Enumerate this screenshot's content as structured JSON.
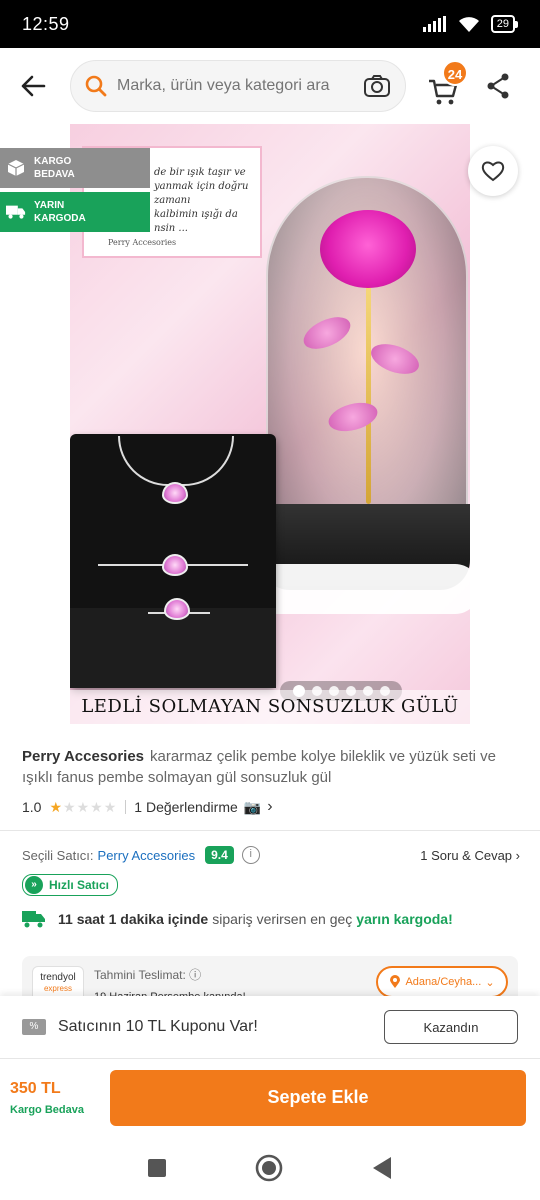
{
  "status": {
    "time": "12:59",
    "battery": "29"
  },
  "search": {
    "placeholder": "Marka, ürün veya kategori ara"
  },
  "cart": {
    "count": "24"
  },
  "badges": {
    "kargo": [
      "KARGO",
      "BEDAVA"
    ],
    "yarin": [
      "YARIN",
      "KARGODA"
    ]
  },
  "image": {
    "note_lines": [
      "de bir ışık taşır ve",
      "yanmak için doğru zamanı",
      "kalbimin ışığı da",
      "nsin ..."
    ],
    "note_signature": "Perry Accesories",
    "caption": "LEDLİ SOLMAYAN SONSUZLUK GÜLÜ"
  },
  "gallery": {
    "dot_count": 6,
    "active_index": 0
  },
  "product": {
    "brand": "Perry Accesories",
    "title": "kararmaz çelik pembe kolye  bileklik ve yüzük seti ve ışıklı fanus pembe solmayan  gül sonsuzluk gül",
    "rating": "1.0",
    "rating_value": 1,
    "reviews": "1 Değerlendirme"
  },
  "seller": {
    "label": "Seçili Satıcı:",
    "name": "Perry Accesories",
    "score": "9.4",
    "qa": "1 Soru & Cevap",
    "fast_badge": "Hızlı Satıcı"
  },
  "delivery": {
    "time_bold": "11 saat 1 dakika içinde",
    "middle": "sipariş verirsen en geç",
    "green": "yarın kargoda!",
    "logo_top": "trendyol",
    "logo_bottom": "express",
    "estimate_label": "Tahmini Teslimat:",
    "estimate_date": "19 Haziran Perşembe kapında!",
    "location": "Adana/Ceyha..."
  },
  "coupon": {
    "text": "Satıcının 10 TL Kuponu Var!",
    "button": "Kazandın"
  },
  "purchase": {
    "price": "350 TL",
    "shipping": "Kargo Bedava",
    "button": "Sepete Ekle"
  },
  "colors": {
    "accent": "#f27a1a",
    "green": "#19a25a",
    "link": "#1b6fbf"
  }
}
